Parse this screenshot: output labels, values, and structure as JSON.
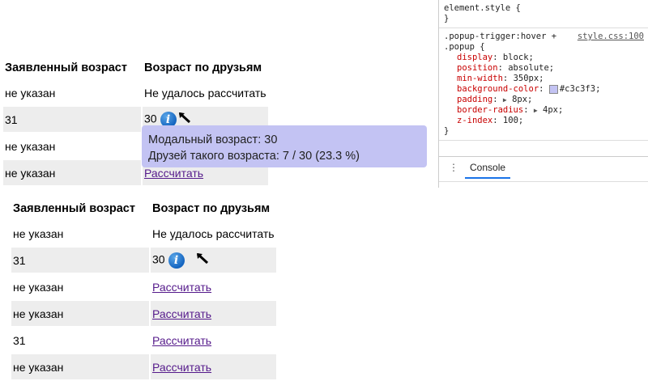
{
  "table_top": {
    "headers": [
      "Заявленный возраст",
      "Возраст по друзьям"
    ],
    "rows": [
      {
        "declared": "не указан",
        "by_friends": "Не удалось рассчитать"
      },
      {
        "declared": "31",
        "by_friends": "30"
      },
      {
        "declared": "не указан",
        "by_friends": ""
      },
      {
        "declared": "не указан",
        "by_friends": "Рассчитать"
      }
    ]
  },
  "popup": {
    "line1": "Модальный возраст: 30",
    "line2": "Друзей такого возраста: 7 / 30 (23.3 %)"
  },
  "table_bottom": {
    "headers": [
      "Заявленный возраст",
      "Возраст по друзьям"
    ],
    "rows": [
      {
        "declared": "не указан",
        "by_friends": "Не удалось рассчитать"
      },
      {
        "declared": "31",
        "by_friends": "30"
      },
      {
        "declared": "не указан",
        "by_friends": "Рассчитать"
      },
      {
        "declared": "не указан",
        "by_friends": "Рассчитать"
      },
      {
        "declared": "31",
        "by_friends": "Рассчитать"
      },
      {
        "declared": "не указан",
        "by_friends": "Рассчитать"
      }
    ]
  },
  "devtools": {
    "element_style": "element.style {",
    "element_style_close": "}",
    "rule_selector_1": ".popup-trigger:hover +",
    "rule_selector_2": ".popup {",
    "rule_source": "style.css:100",
    "props": [
      {
        "name": "display",
        "value": "block;"
      },
      {
        "name": "position",
        "value": "absolute;"
      },
      {
        "name": "min-width",
        "value": "350px;"
      },
      {
        "name": "background-color",
        "value": "#c3c3f3;"
      },
      {
        "name": "padding",
        "value": "8px;"
      },
      {
        "name": "border-radius",
        "value": "4px;"
      },
      {
        "name": "z-index",
        "value": "100;"
      }
    ],
    "rule_close": "}",
    "console_tab": "Console"
  },
  "colors": {
    "popup_bg": "#c3c3f3",
    "link": "#551a8b",
    "row_alt": "#ededed"
  }
}
